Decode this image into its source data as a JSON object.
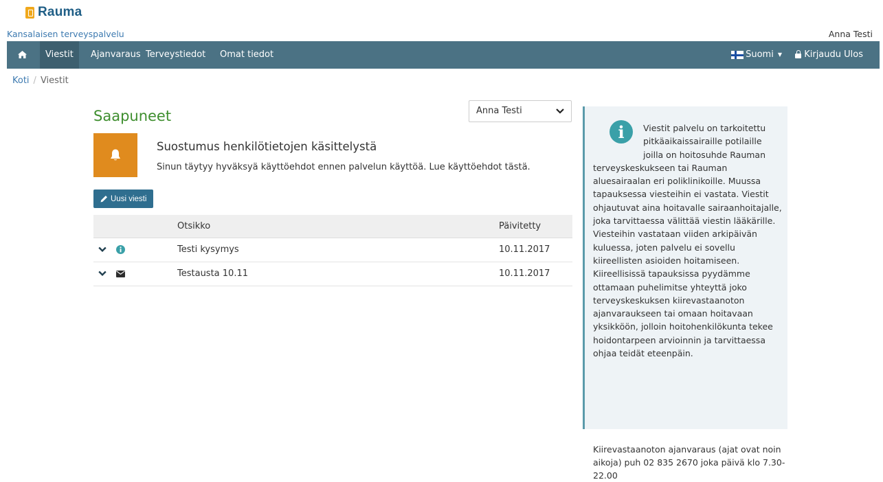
{
  "brand": {
    "logo_text": "Rauma",
    "logo_color": "#1f5e86",
    "mark_color": "#f0a81c"
  },
  "header": {
    "service_link": "Kansalaisen terveyspalvelu",
    "user_name": "Anna Testi"
  },
  "nav": {
    "home_icon": "home-icon",
    "items": [
      "Viestit",
      "Ajanvaraus",
      "Terveystiedot",
      "Omat tiedot"
    ],
    "active": "Viestit",
    "language": "Suomi",
    "logout": "Kirjaudu Ulos",
    "bar_color": "#4b7284"
  },
  "breadcrumb": {
    "home": "Koti",
    "separator": "/",
    "current": "Viestit"
  },
  "main": {
    "title": "Saapuneet",
    "recipient_select": "Anna Testi",
    "notice": {
      "icon": "bell-icon",
      "title": "Suostumus henkilötietojen käsittelystä",
      "text": "Sinun täytyy hyväksyä käyttöehdot ennen palvelun käyttöä. Lue käyttöehdot tästä."
    },
    "new_message_button": "Uusi viesti",
    "table": {
      "columns": [
        "Otsikko",
        "Päivitetty"
      ],
      "rows": [
        {
          "icon": "info-circle-icon",
          "title": "Testi kysymys",
          "updated": "10.11.2017"
        },
        {
          "icon": "envelope-icon",
          "title": "Testausta 10.11",
          "updated": "10.11.2017"
        }
      ]
    }
  },
  "sidebar": {
    "info_text": "Viestit palvelu on tarkoitettu pitkäaikaissairaille potilaille joilla on hoitosuhde Rauman terveyskeskukseen tai Rauman aluesairaalan eri poliklinikoille. Muussa tapauksessa viesteihin ei vastata. Viestit ohjautuvat aina hoitavalle sairaanhoitajalle, joka tarvittaessa välittää viestin lääkärille. Viesteihin vastataan viiden arkipäivän kuluessa, joten palvelu ei sovellu kiireellisten asioiden hoitamiseen. Kiireellisissä tapauksissa pyydämme ottamaan puhelimitse yhteyttä joko terveyskeskuksen kiirevastaanoton ajanvaraukseen tai omaan hoitavaan yksikköön, jolloin hoitohenkilökunta tekee hoidontarpeen arvioinnin ja tarvittaessa ohjaa teidät eteenpäin.",
    "footer_note": "Kiirevastaanoton ajanvaraus (ajat ovat noin aikoja) puh 02 835 2670 joka päivä klo 7.30-22.00"
  }
}
